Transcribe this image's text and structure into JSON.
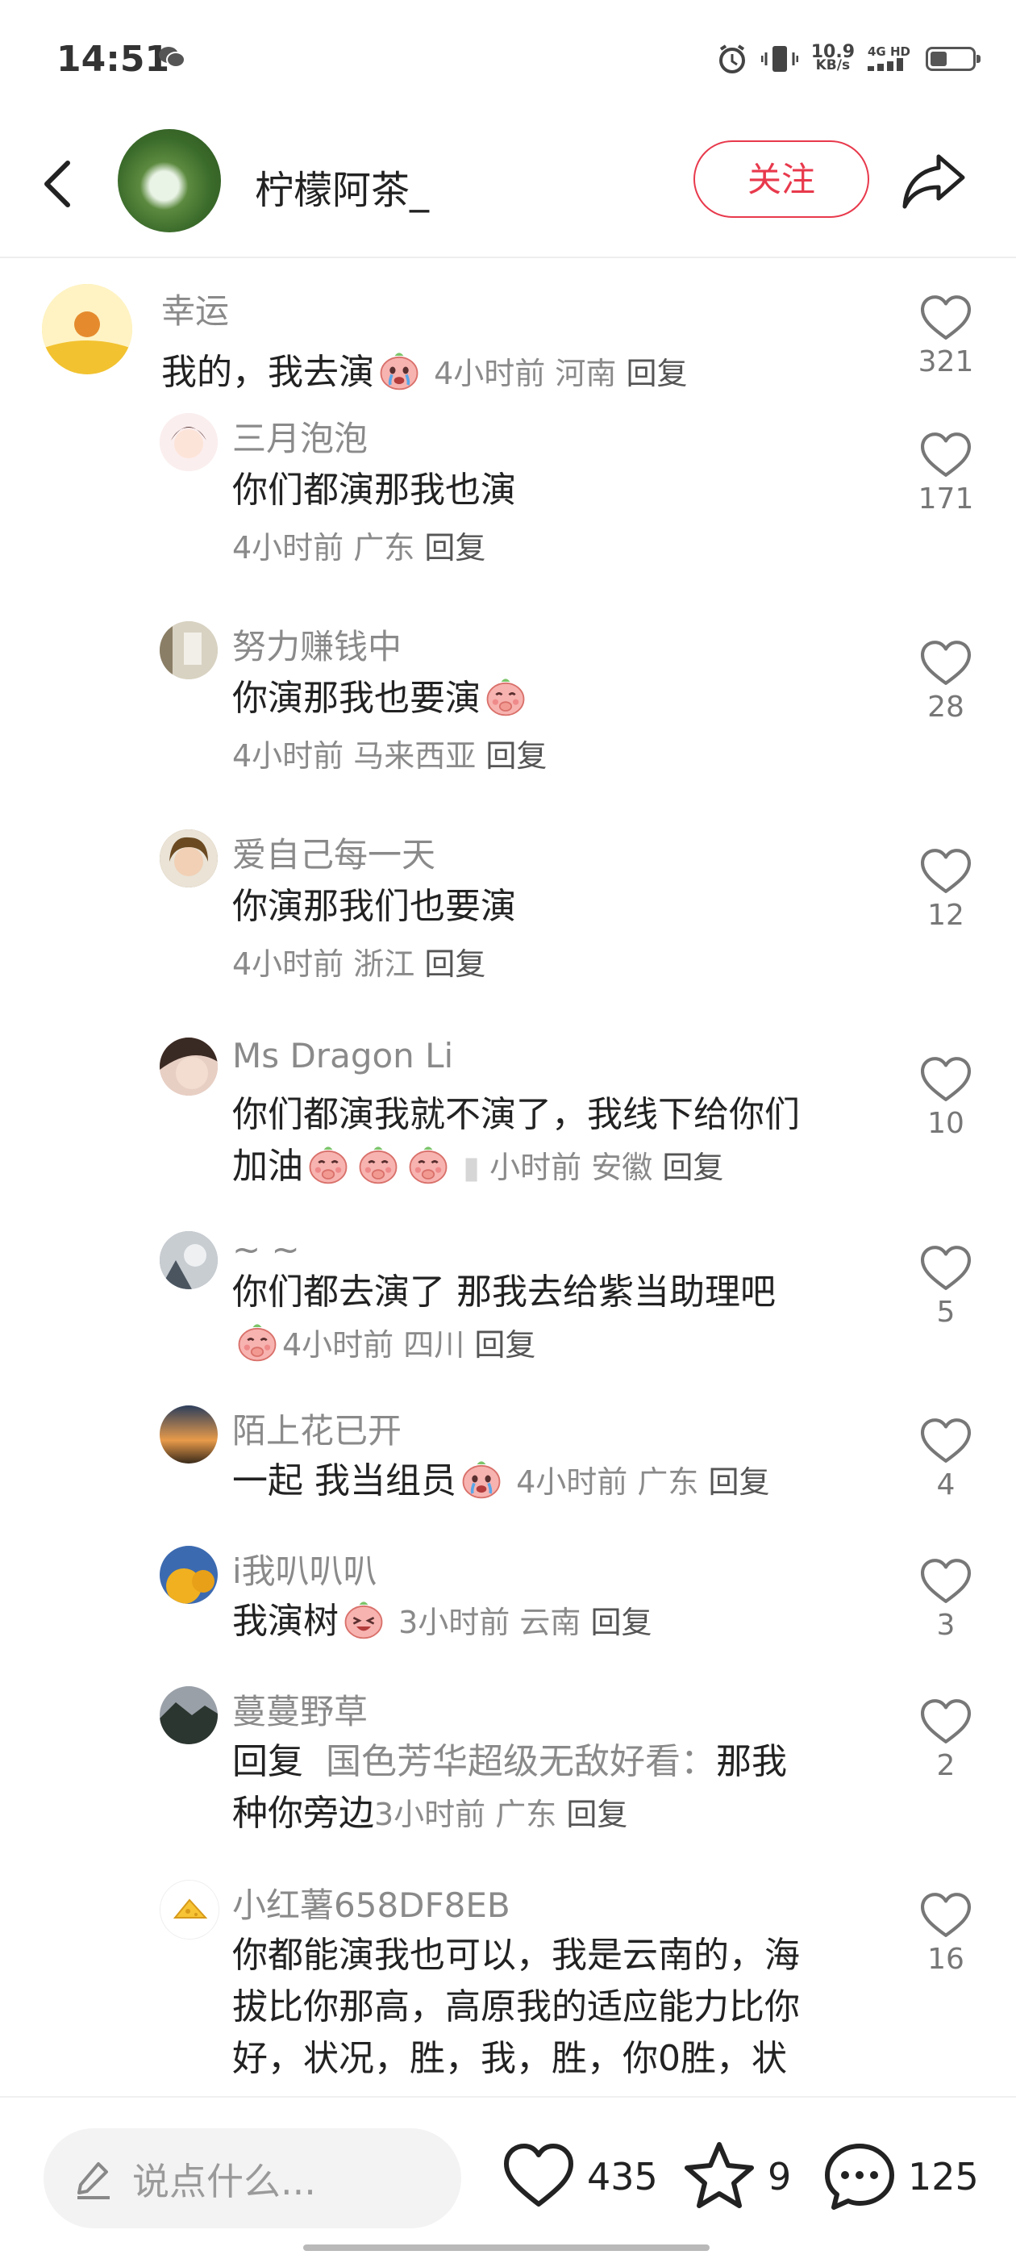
{
  "status_bar": {
    "time": "14:51",
    "net_speed_value": "10.9",
    "net_speed_unit": "KB/s",
    "network_label": "4G HD",
    "battery_level": 0.35
  },
  "header": {
    "title": "柠檬阿茶_",
    "follow_label": "关注"
  },
  "comments": [
    {
      "user": "幸运",
      "text": "我的，我去演",
      "emoji": true,
      "meta_time": "4小时前",
      "meta_loc": "河南",
      "reply": "回复",
      "likes": "321"
    },
    {
      "user": "三月泡泡",
      "text": "你们都演那我也演",
      "meta_time": "4小时前",
      "meta_loc": "广东",
      "reply": "回复",
      "likes": "171"
    },
    {
      "user": "努力赚钱中",
      "text": "你演那我也要演",
      "meta_time": "4小时前",
      "meta_loc": "马来西亚",
      "reply": "回复",
      "likes": "28"
    },
    {
      "user": "爱自己每一天",
      "text": "你演那我们也要演",
      "meta_time": "4小时前",
      "meta_loc": "浙江",
      "reply": "回复",
      "likes": "12"
    },
    {
      "user": "Ms Dragon Li",
      "text_line1": "你们都演我就不演了，我线下给你们",
      "text_line2": "加油",
      "meta_time": "小时前",
      "meta_loc": "安徽",
      "reply": "回复",
      "likes": "10"
    },
    {
      "user": "~ ~",
      "text": "你们都去演了 那我去给紫当助理吧",
      "meta_time": "4小时前",
      "meta_loc": "四川",
      "reply": "回复",
      "likes": "5"
    },
    {
      "user": "陌上花已开",
      "text": "一起 我当组员",
      "meta_time": "4小时前",
      "meta_loc": "广东",
      "reply": "回复",
      "likes": "4"
    },
    {
      "user": "i我叭叭叭",
      "text": "我演树",
      "meta_time": "3小时前",
      "meta_loc": "云南",
      "reply": "回复",
      "likes": "3"
    },
    {
      "user": "蔓蔓野草",
      "reply_prefix": "回复",
      "quoted_user": "国色芳华超级无敌好看：",
      "text_line1": "那我",
      "text_line2": "种你旁边",
      "meta_time": "3小时前",
      "meta_loc": "广东",
      "reply": "回复",
      "likes": "2"
    },
    {
      "user": "小红薯658DF8EB",
      "text_line1": "你都能演我也可以，我是云南的，海",
      "text_line2": "拔比你那高，高原我的适应能力比你",
      "text_line3": "好，状况，胜，我，胜，你0胜，状",
      "likes": "16"
    }
  ],
  "bottom_bar": {
    "input_placeholder": "说点什么...",
    "like_count": "435",
    "collect_count": "9",
    "comment_count": "125"
  },
  "colors": {
    "accent": "#e8394c",
    "secondary_text": "#8a8a8a"
  }
}
